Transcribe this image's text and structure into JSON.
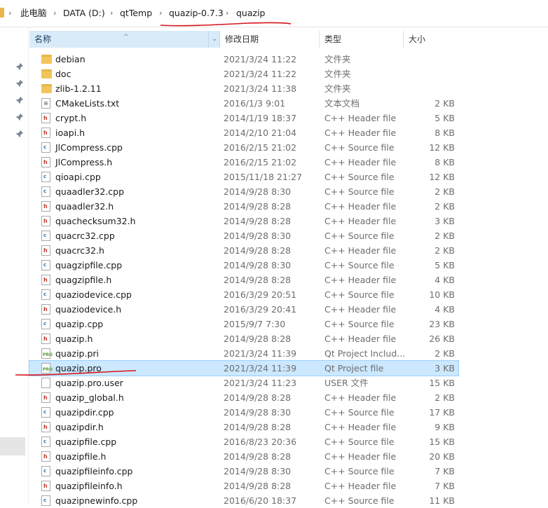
{
  "breadcrumb": {
    "items": [
      "此电脑",
      "DATA (D:)",
      "qtTemp",
      "quazip-0.7.3",
      "quazip"
    ]
  },
  "header": {
    "name": "名称",
    "date": "修改日期",
    "type": "类型",
    "size": "大小"
  },
  "files": [
    {
      "name": "debian",
      "date": "2021/3/24 11:22",
      "type": "文件夹",
      "size": "",
      "icon": "folder"
    },
    {
      "name": "doc",
      "date": "2021/3/24 11:22",
      "type": "文件夹",
      "size": "",
      "icon": "folder"
    },
    {
      "name": "zlib-1.2.11",
      "date": "2021/3/24 11:38",
      "type": "文件夹",
      "size": "",
      "icon": "folder"
    },
    {
      "name": "CMakeLists.txt",
      "date": "2016/1/3 9:01",
      "type": "文本文档",
      "size": "2 KB",
      "icon": "txt"
    },
    {
      "name": "crypt.h",
      "date": "2014/1/19 18:37",
      "type": "C++ Header file",
      "size": "5 KB",
      "icon": "h"
    },
    {
      "name": "ioapi.h",
      "date": "2014/2/10 21:04",
      "type": "C++ Header file",
      "size": "8 KB",
      "icon": "h"
    },
    {
      "name": "JlCompress.cpp",
      "date": "2016/2/15 21:02",
      "type": "C++ Source file",
      "size": "12 KB",
      "icon": "cpp"
    },
    {
      "name": "JlCompress.h",
      "date": "2016/2/15 21:02",
      "type": "C++ Header file",
      "size": "8 KB",
      "icon": "h"
    },
    {
      "name": "qioapi.cpp",
      "date": "2015/11/18 21:27",
      "type": "C++ Source file",
      "size": "12 KB",
      "icon": "cpp"
    },
    {
      "name": "quaadler32.cpp",
      "date": "2014/9/28 8:30",
      "type": "C++ Source file",
      "size": "2 KB",
      "icon": "cpp"
    },
    {
      "name": "quaadler32.h",
      "date": "2014/9/28 8:28",
      "type": "C++ Header file",
      "size": "2 KB",
      "icon": "h"
    },
    {
      "name": "quachecksum32.h",
      "date": "2014/9/28 8:28",
      "type": "C++ Header file",
      "size": "3 KB",
      "icon": "h"
    },
    {
      "name": "quacrc32.cpp",
      "date": "2014/9/28 8:30",
      "type": "C++ Source file",
      "size": "2 KB",
      "icon": "cpp"
    },
    {
      "name": "quacrc32.h",
      "date": "2014/9/28 8:28",
      "type": "C++ Header file",
      "size": "2 KB",
      "icon": "h"
    },
    {
      "name": "quagzipfile.cpp",
      "date": "2014/9/28 8:30",
      "type": "C++ Source file",
      "size": "5 KB",
      "icon": "cpp"
    },
    {
      "name": "quagzipfile.h",
      "date": "2014/9/28 8:28",
      "type": "C++ Header file",
      "size": "4 KB",
      "icon": "h"
    },
    {
      "name": "quaziodevice.cpp",
      "date": "2016/3/29 20:51",
      "type": "C++ Source file",
      "size": "10 KB",
      "icon": "cpp"
    },
    {
      "name": "quaziodevice.h",
      "date": "2016/3/29 20:41",
      "type": "C++ Header file",
      "size": "4 KB",
      "icon": "h"
    },
    {
      "name": "quazip.cpp",
      "date": "2015/9/7 7:30",
      "type": "C++ Source file",
      "size": "23 KB",
      "icon": "cpp"
    },
    {
      "name": "quazip.h",
      "date": "2014/9/28 8:28",
      "type": "C++ Header file",
      "size": "26 KB",
      "icon": "h"
    },
    {
      "name": "quazip.pri",
      "date": "2021/3/24 11:39",
      "type": "Qt Project Includ...",
      "size": "2 KB",
      "icon": "pro"
    },
    {
      "name": "quazip.pro",
      "date": "2021/3/24 11:39",
      "type": "Qt Project file",
      "size": "3 KB",
      "icon": "pro",
      "selected": true
    },
    {
      "name": "quazip.pro.user",
      "date": "2021/3/24 11:23",
      "type": "USER 文件",
      "size": "15 KB",
      "icon": "blank"
    },
    {
      "name": "quazip_global.h",
      "date": "2014/9/28 8:28",
      "type": "C++ Header file",
      "size": "2 KB",
      "icon": "h"
    },
    {
      "name": "quazipdir.cpp",
      "date": "2014/9/28 8:30",
      "type": "C++ Source file",
      "size": "17 KB",
      "icon": "cpp"
    },
    {
      "name": "quazipdir.h",
      "date": "2014/9/28 8:28",
      "type": "C++ Header file",
      "size": "9 KB",
      "icon": "h"
    },
    {
      "name": "quazipfile.cpp",
      "date": "2016/8/23 20:36",
      "type": "C++ Source file",
      "size": "15 KB",
      "icon": "cpp"
    },
    {
      "name": "quazipfile.h",
      "date": "2014/9/28 8:28",
      "type": "C++ Header file",
      "size": "20 KB",
      "icon": "h"
    },
    {
      "name": "quazipfileinfo.cpp",
      "date": "2014/9/28 8:30",
      "type": "C++ Source file",
      "size": "7 KB",
      "icon": "cpp"
    },
    {
      "name": "quazipfileinfo.h",
      "date": "2014/9/28 8:28",
      "type": "C++ Header file",
      "size": "7 KB",
      "icon": "h"
    },
    {
      "name": "quazipnewinfo.cpp",
      "date": "2016/6/20 18:37",
      "type": "C++ Source file",
      "size": "11 KB",
      "icon": "cpp"
    }
  ],
  "colors": {
    "selection": "#cce8ff",
    "annotation": "#d6141b"
  }
}
